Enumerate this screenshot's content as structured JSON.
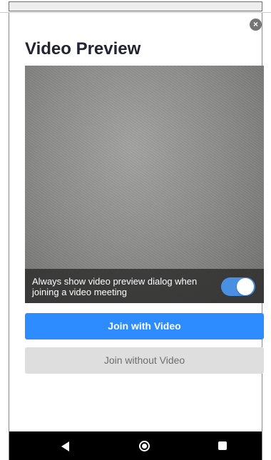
{
  "dialog": {
    "title": "Video Preview",
    "close_icon": "close-icon"
  },
  "preview": {
    "caption": "Always show video preview dialog when joining a video meeting",
    "toggle_on": true,
    "toggle_color": "#4a90e2"
  },
  "buttons": {
    "join_with_video": "Join with Video",
    "join_without_video": "Join without Video",
    "primary_color": "#2d8cff"
  },
  "navigation": {
    "back_icon": "back-triangle-icon",
    "home_icon": "home-circle-icon",
    "recents_icon": "recents-square-icon"
  }
}
